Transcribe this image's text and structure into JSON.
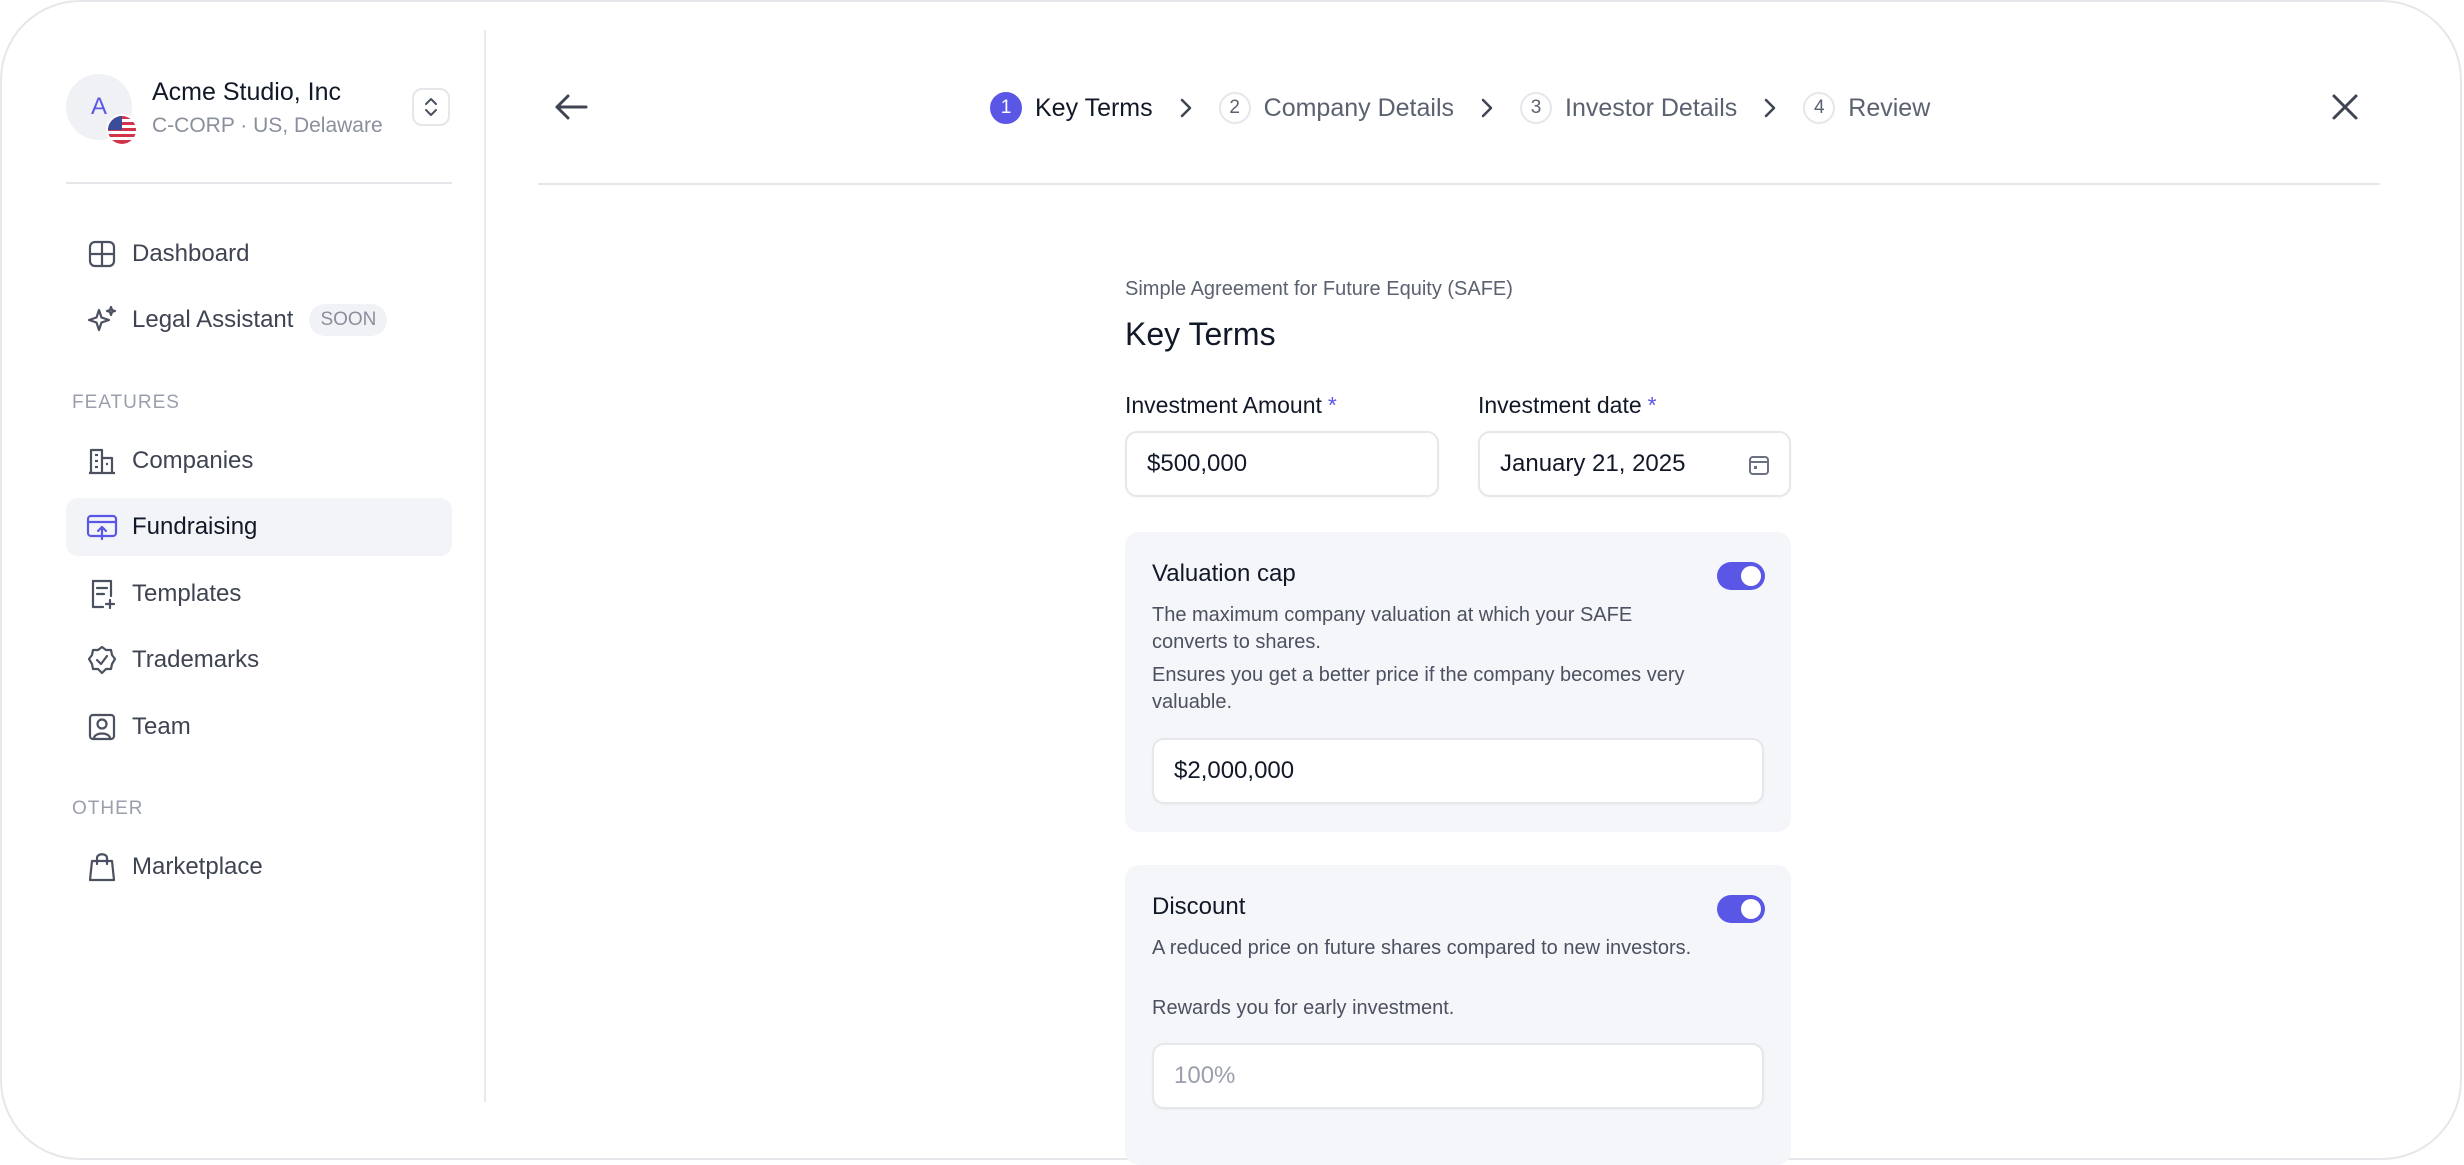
{
  "org": {
    "avatar_letter": "A",
    "name": "Acme Studio, Inc",
    "subtitle": "C-CORP · US, Delaware"
  },
  "sidebar": {
    "primary": [
      {
        "label": "Dashboard",
        "icon": "dashboard-icon"
      },
      {
        "label": "Legal Assistant",
        "icon": "sparkle-icon",
        "badge": "SOON"
      }
    ],
    "features_label": "FEATURES",
    "features": [
      {
        "label": "Companies",
        "icon": "building-icon"
      },
      {
        "label": "Fundraising",
        "icon": "fundraising-icon",
        "active": true
      },
      {
        "label": "Templates",
        "icon": "template-icon"
      },
      {
        "label": "Trademarks",
        "icon": "trademark-badge-icon"
      },
      {
        "label": "Team",
        "icon": "team-icon"
      }
    ],
    "other_label": "OTHER",
    "other": [
      {
        "label": "Marketplace",
        "icon": "shopping-bag-icon"
      }
    ]
  },
  "steps": [
    {
      "num": "1",
      "label": "Key Terms",
      "active": true
    },
    {
      "num": "2",
      "label": "Company Details"
    },
    {
      "num": "3",
      "label": "Investor Details"
    },
    {
      "num": "4",
      "label": "Review"
    }
  ],
  "form": {
    "eyebrow": "Simple Agreement for Future Equity (SAFE)",
    "title": "Key Terms",
    "investment_amount": {
      "label": "Investment Amount",
      "required": "*",
      "value": "$500,000"
    },
    "investment_date": {
      "label": "Investment date",
      "required": "*",
      "value": "January 21, 2025"
    },
    "valuation_cap": {
      "title": "Valuation cap",
      "desc1": "The maximum company valuation at which your SAFE converts to shares.",
      "desc2": "Ensures you get a better price if the company becomes very valuable.",
      "value": "$2,000,000",
      "enabled": true
    },
    "discount": {
      "title": "Discount",
      "desc1": "A reduced price on future shares compared to new investors.",
      "desc2": "Rewards you for early investment.",
      "placeholder": "100%",
      "enabled": true
    }
  },
  "colors": {
    "accent": "#5b57e6",
    "border": "#e5e7eb",
    "card_bg": "#f5f6fa"
  }
}
